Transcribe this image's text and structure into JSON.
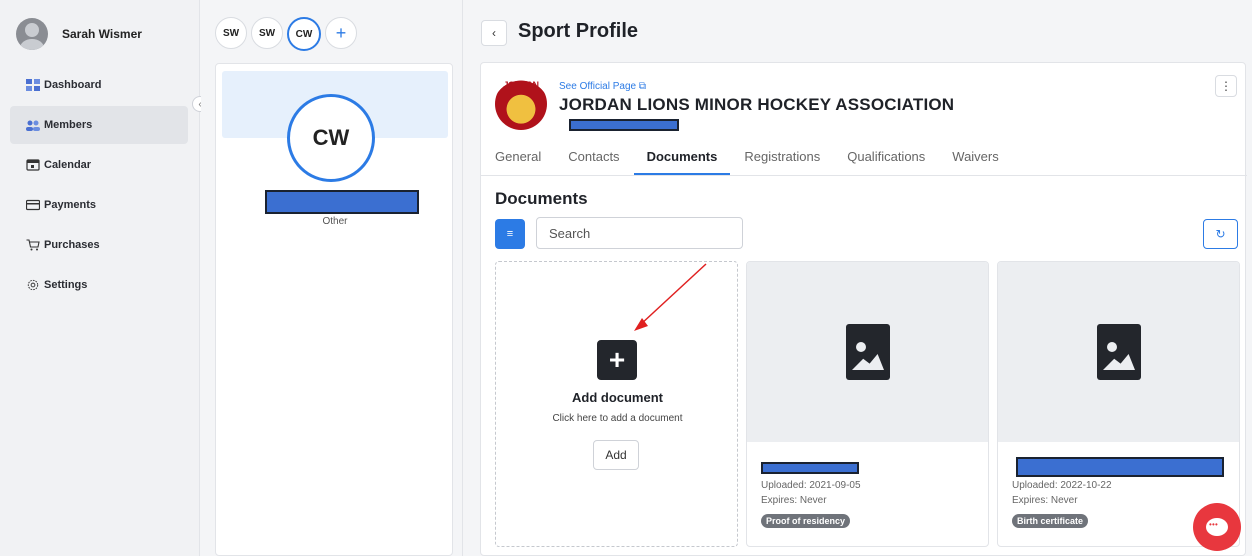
{
  "user": {
    "name": "Sarah Wismer"
  },
  "nav": {
    "items": [
      {
        "label": "Dashboard",
        "icon": "dashboard-icon",
        "active": false
      },
      {
        "label": "Members",
        "icon": "members-icon",
        "active": true
      },
      {
        "label": "Calendar",
        "icon": "calendar-icon",
        "active": false
      },
      {
        "label": "Payments",
        "icon": "card-icon",
        "active": false
      },
      {
        "label": "Purchases",
        "icon": "cart-icon",
        "active": false
      },
      {
        "label": "Settings",
        "icon": "gear-icon",
        "active": false
      }
    ]
  },
  "members": {
    "chips": [
      "SW",
      "SW",
      "CW"
    ],
    "add_symbol": "+",
    "selected": {
      "initials": "CW",
      "role": "Other"
    }
  },
  "header": {
    "back_symbol": "‹",
    "title": "Sport Profile"
  },
  "org": {
    "logo_text": "JORDAN",
    "official_link": "See Official Page ⧉",
    "name": "JORDAN LIONS MINOR HOCKEY ASSOCIATION",
    "more_symbol": "⋮"
  },
  "tabs": [
    "General",
    "Contacts",
    "Documents",
    "Registrations",
    "Qualifications",
    "Waivers"
  ],
  "active_tab": "Documents",
  "documents": {
    "title": "Documents",
    "filter_symbol": "≡",
    "search_placeholder": "Search",
    "refresh_symbol": "↻",
    "add_card": {
      "symbol": "+",
      "title": "Add document",
      "subtitle": "Click here to add a document",
      "button": "Add"
    },
    "items": [
      {
        "uploaded": "Uploaded: 2021-09-05",
        "expires": "Expires: Never",
        "type": "Proof of residency"
      },
      {
        "uploaded": "Uploaded: 2022-10-22",
        "expires": "Expires: Never",
        "type": "Birth certificate"
      }
    ]
  },
  "colors": {
    "accent": "#2c7be5",
    "chat": "#e8373e",
    "annotation_arrow": "#e02020"
  }
}
